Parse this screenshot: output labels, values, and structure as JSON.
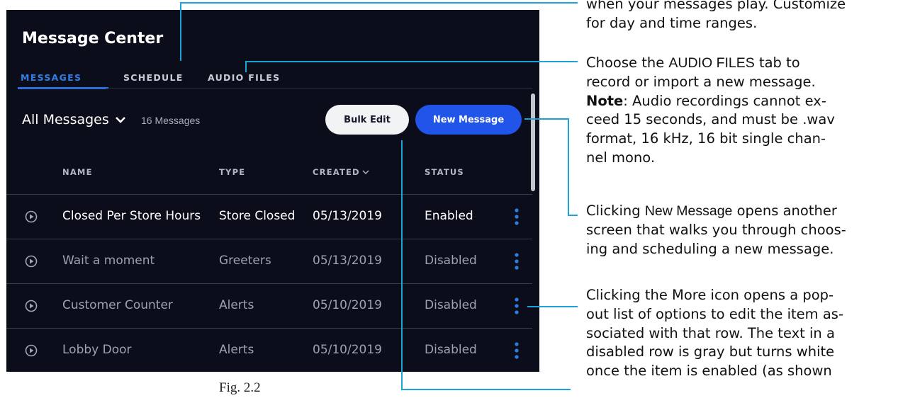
{
  "app": {
    "title": "Message Center",
    "tabs": [
      {
        "label": "MESSAGES",
        "active": true
      },
      {
        "label": "SCHEDULE",
        "active": false
      },
      {
        "label": "AUDIO FILES",
        "active": false
      }
    ],
    "filter": {
      "label": "All Messages",
      "icon": "chevron-down-icon"
    },
    "message_count": "16 Messages",
    "buttons": {
      "bulk_edit": "Bulk Edit",
      "new_message": "New Message"
    },
    "columns": {
      "name": "NAME",
      "type": "TYPE",
      "created": "CREATED",
      "created_sort_icon": "sort-down-icon",
      "status": "STATUS"
    },
    "rows": [
      {
        "name": "Closed Per Store Hours",
        "type": "Store Closed",
        "created": "05/13/2019",
        "status": "Enabled"
      },
      {
        "name": "Wait a moment",
        "type": "Greeters",
        "created": "05/13/2019",
        "status": "Disabled"
      },
      {
        "name": "Customer Counter",
        "type": "Alerts",
        "created": "05/10/2019",
        "status": "Disabled"
      },
      {
        "name": "Lobby Door",
        "type": "Alerts",
        "created": "05/10/2019",
        "status": "Disabled"
      }
    ]
  },
  "colors": {
    "background": "#0b0d1a",
    "accent": "#2f7fe6",
    "primary_button": "#2154e8",
    "annotation_line": "#1aa3d9"
  },
  "annotations": {
    "a1_line1": "when your messages play. Customize",
    "a1_line2": "for day and time ranges.",
    "a2_line1_pre": "Choose the ",
    "a2_line1_key": "AUDIO FILES",
    "a2_line1_post": " tab to",
    "a2_line2": "record or import a new message.",
    "a2_note_label": "Note",
    "a2_line3_rest": ": Audio recordings cannot ex-",
    "a2_line4": "ceed 15 seconds, and must be .wav",
    "a2_line5": "format, 16 kHz, 16 bit single chan-",
    "a2_line6": "nel mono.",
    "a3_line1_pre": "Clicking ",
    "a3_line1_key": "New Message",
    "a3_line1_post": " opens another",
    "a3_line2": "screen that walks you through choos-",
    "a3_line3": "ing and scheduling a new message.",
    "a4_line1": "Clicking the More icon opens a pop-",
    "a4_line2": "out list of options to edit the item as-",
    "a4_line3": "sociated with that row. The text in a",
    "a4_line4": "disabled row is gray but turns white",
    "a4_line5": "once the item is enabled (as shown"
  },
  "caption": "Fig. 2.2"
}
